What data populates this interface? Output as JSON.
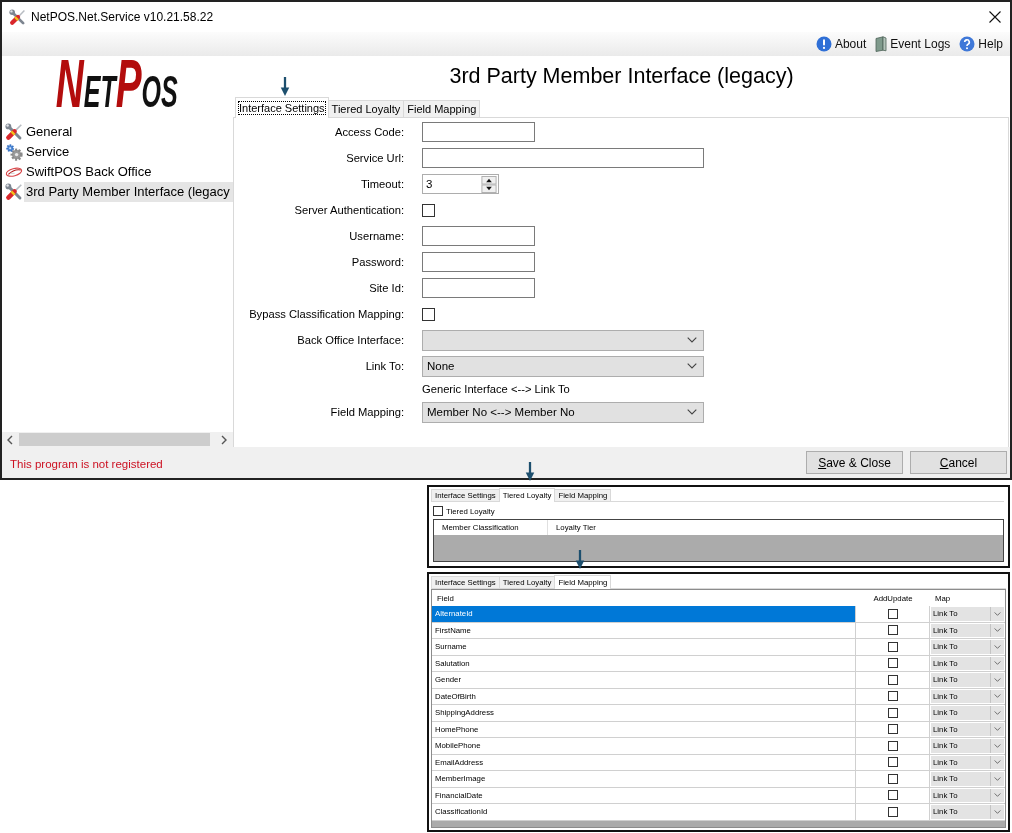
{
  "window": {
    "title": "NetPOS.Net.Service v10.21.58.22"
  },
  "toolbar": {
    "links": [
      {
        "label": "About"
      },
      {
        "label": "Event Logs"
      },
      {
        "label": "Help"
      }
    ]
  },
  "logo": {
    "parts": [
      {
        "text": "N",
        "accent": true
      },
      {
        "text": "ET",
        "accent": false
      },
      {
        "text": "P",
        "accent": true
      },
      {
        "text": "OS",
        "accent": false
      }
    ]
  },
  "sidebar": {
    "items": [
      {
        "label": "General",
        "selected": false
      },
      {
        "label": "Service",
        "selected": false
      },
      {
        "label": "SwiftPOS Back Office",
        "selected": false
      },
      {
        "label": "3rd Party Member Interface (legacy",
        "selected": true
      }
    ]
  },
  "page": {
    "title": "3rd Party Member Interface (legacy)",
    "tabs": [
      {
        "label": "Interface Settings",
        "selected": true
      },
      {
        "label": "Tiered Loyalty",
        "selected": false
      },
      {
        "label": "Field Mapping",
        "selected": false
      }
    ],
    "form": [
      {
        "kind": "text",
        "label": "Access Code:"
      },
      {
        "kind": "longtext",
        "label": "Service Url:"
      },
      {
        "kind": "spinner",
        "label": "Timeout:",
        "value": "3"
      },
      {
        "kind": "checkbox",
        "label": "Server Authentication:",
        "checked": false
      },
      {
        "kind": "text",
        "label": "Username:"
      },
      {
        "kind": "text",
        "label": "Password:"
      },
      {
        "kind": "text",
        "label": "Site Id:"
      },
      {
        "kind": "checkbox",
        "label": "Bypass Classification Mapping:",
        "checked": false
      },
      {
        "kind": "combo",
        "label": "Back Office Interface:"
      },
      {
        "kind": "combo",
        "label": "Link To:",
        "value": "None"
      },
      {
        "kind": "note",
        "text": "Generic Interface <--> Link To"
      },
      {
        "kind": "combo",
        "label": "Field Mapping:",
        "value": "Member No <--> Member No"
      }
    ]
  },
  "status_bar": {
    "message": "This program is not registered"
  },
  "buttons": [
    {
      "label": "Save & Close"
    },
    {
      "label": "Cancel"
    }
  ],
  "tiered_loyalty_view": {
    "tabs": [
      {
        "label": "Interface Settings",
        "selected": false
      },
      {
        "label": "Tiered Loyalty",
        "selected": true
      },
      {
        "label": "Field Mapping",
        "selected": false
      }
    ],
    "option": {
      "label": "Tiered Loyalty",
      "checked": false
    },
    "columns": [
      "Member Classification",
      "Loyalty Tier"
    ]
  },
  "field_mapping_view": {
    "tabs": [
      {
        "label": "Interface Settings",
        "selected": false
      },
      {
        "label": "Tiered Loyalty",
        "selected": false
      },
      {
        "label": "Field Mapping",
        "selected": true
      }
    ],
    "columns": [
      "Field",
      "AddUpdate",
      "Map"
    ],
    "rows": [
      {
        "field": "AlternateId",
        "add_update": false,
        "map": "Link To",
        "selected": true
      },
      {
        "field": "FirstName",
        "add_update": false,
        "map": "Link To",
        "selected": false
      },
      {
        "field": "Surname",
        "add_update": false,
        "map": "Link To",
        "selected": false
      },
      {
        "field": "Salutation",
        "add_update": false,
        "map": "Link To",
        "selected": false
      },
      {
        "field": "Gender",
        "add_update": false,
        "map": "Link To",
        "selected": false
      },
      {
        "field": "DateOfBirth",
        "add_update": false,
        "map": "Link To",
        "selected": false
      },
      {
        "field": "ShippingAddress",
        "add_update": false,
        "map": "Link To",
        "selected": false
      },
      {
        "field": "HomePhone",
        "add_update": false,
        "map": "Link To",
        "selected": false
      },
      {
        "field": "MobilePhone",
        "add_update": false,
        "map": "Link To",
        "selected": false
      },
      {
        "field": "EmailAddress",
        "add_update": false,
        "map": "Link To",
        "selected": false
      },
      {
        "field": "MemberImage",
        "add_update": false,
        "map": "Link To",
        "selected": false
      },
      {
        "field": "FinancialDate",
        "add_update": false,
        "map": "Link To",
        "selected": false
      },
      {
        "field": "ClassificationId",
        "add_update": false,
        "map": "Link To",
        "selected": false
      }
    ]
  }
}
